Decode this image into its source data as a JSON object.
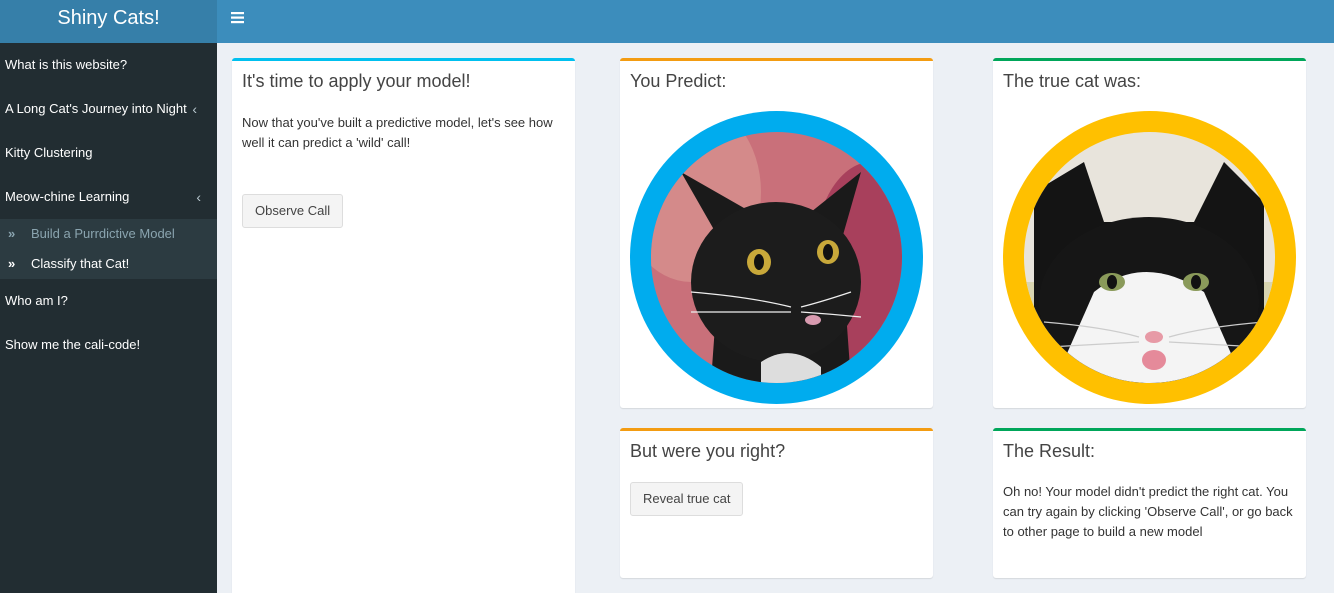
{
  "app": {
    "title": "Shiny Cats!"
  },
  "header": {
    "menu_icon": "bars-icon"
  },
  "sidebar": {
    "items": [
      {
        "label": "What is this website?"
      },
      {
        "label": "A Long Cat's Journey into Night",
        "chevron": "‹"
      },
      {
        "label": "Kitty Clustering"
      },
      {
        "label": "Meow-chine Learning",
        "chevron": "‹"
      }
    ],
    "subitems": [
      {
        "label": "Build a Purrdictive Model",
        "icon": "»"
      },
      {
        "label": "Classify that Cat!",
        "icon": "»"
      }
    ],
    "bottom_items": [
      {
        "label": "Who am I?"
      },
      {
        "label": "Show me the cali-code!"
      }
    ]
  },
  "apply_box": {
    "title": "It's time to apply your model!",
    "text": "Now that you've built a predictive model, let's see how well it can predict a 'wild' call!",
    "button": "Observe Call",
    "color": "#00c0ef"
  },
  "predict_box": {
    "title": "You Predict:",
    "color": "#f39c12",
    "ring_color": "#00acee"
  },
  "true_box": {
    "title": "The true cat was:",
    "color": "#00a65a",
    "ring_color": "#ffc000"
  },
  "right_box": {
    "title": "But were you right?",
    "button": "Reveal true cat",
    "color": "#f39c12"
  },
  "result_box": {
    "title": "The Result:",
    "text": "Oh no! Your model didn't predict the right cat. You can try again by clicking 'Observe Call', or go back to other page to build a new model",
    "color": "#00a65a"
  }
}
